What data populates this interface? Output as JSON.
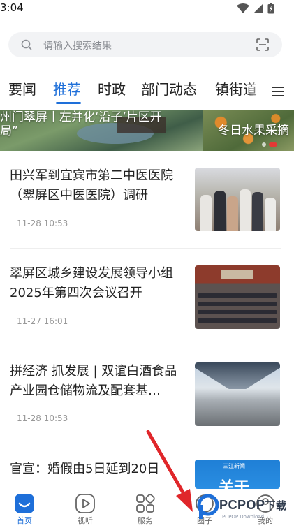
{
  "status_bar": {
    "time": "3:04"
  },
  "search": {
    "placeholder": "请输入搜索结果"
  },
  "tabs": [
    {
      "label": "要闻"
    },
    {
      "label": "推荐"
    },
    {
      "label": "时政"
    },
    {
      "label": "部门动态"
    },
    {
      "label": "镇街道"
    }
  ],
  "active_tab": "推荐",
  "banner": {
    "left_text": "州门翠屏丨左并化‘沿子’片区开\n局”",
    "right_text": "冬日水果采摘"
  },
  "news": [
    {
      "title": "田兴军到宜宾市第二中医医院（翠屏区中医医院）调研",
      "time": "11-28 10:53"
    },
    {
      "title": "翠屏区城乡建设发展领导小组2025年第四次会议召开",
      "time": "11-27 16:01"
    },
    {
      "title": "拼经济 抓发展 | 双谊白酒食品产业园仓储物流及配套基…",
      "time": "11-28 10:53"
    },
    {
      "title": "官宣：婚假由5日延到20日",
      "time": ""
    }
  ],
  "thumb_texts": {
    "tag": "三江新闻",
    "big": "关于"
  },
  "bottom_nav": [
    {
      "label": "首页",
      "icon": "home-icon"
    },
    {
      "label": "视听",
      "icon": "video-icon"
    },
    {
      "label": "服务",
      "icon": "services-icon"
    },
    {
      "label": "圈子",
      "icon": "circle-icon"
    },
    {
      "label": "我的",
      "icon": "profile-icon"
    }
  ],
  "watermark": {
    "brand": "PCPOP",
    "suffix": "下载",
    "sub": "PCPOP Download"
  },
  "colors": {
    "accent": "#1e6fd9",
    "arrow": "#e0262a"
  }
}
